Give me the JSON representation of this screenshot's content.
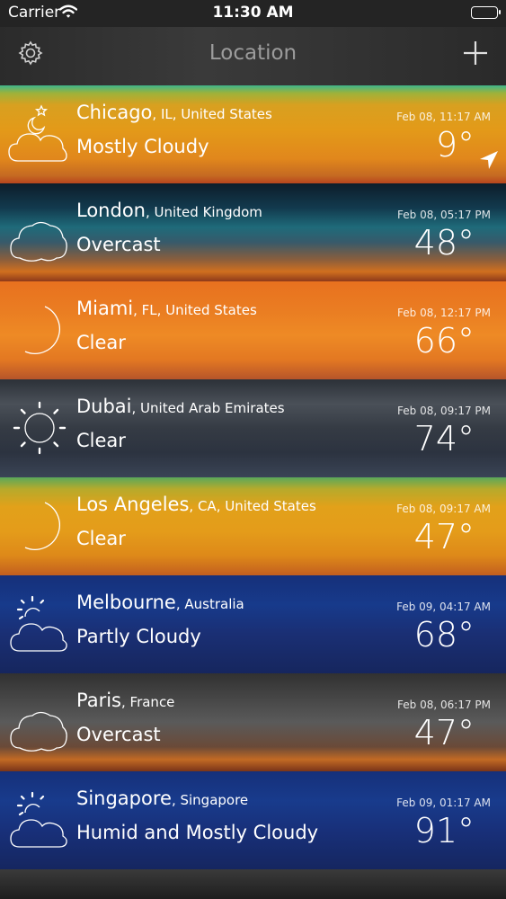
{
  "status_bar": {
    "carrier": "Carrier",
    "time": "11:30 AM"
  },
  "nav": {
    "title": "Location"
  },
  "locations": [
    {
      "city": "Chicago",
      "region": ", IL, United States",
      "condition": "Mostly Cloudy",
      "date": "Feb 08, 11:17 AM",
      "temp": "9°",
      "icon": "partly-cloudy-night-icon",
      "current_location": true
    },
    {
      "city": "London",
      "region": ", United Kingdom",
      "condition": "Overcast",
      "date": "Feb 08, 05:17 PM",
      "temp": "48°",
      "icon": "cloud-icon"
    },
    {
      "city": "Miami",
      "region": ", FL, United States",
      "condition": "Clear",
      "date": "Feb 08, 12:17 PM",
      "temp": "66°",
      "icon": "moon-icon"
    },
    {
      "city": "Dubai",
      "region": ", United Arab Emirates",
      "condition": "Clear",
      "date": "Feb 08, 09:17 PM",
      "temp": "74°",
      "icon": "sun-icon"
    },
    {
      "city": "Los Angeles",
      "region": ", CA, United States",
      "condition": "Clear",
      "date": "Feb 08, 09:17 AM",
      "temp": "47°",
      "icon": "moon-icon"
    },
    {
      "city": "Melbourne",
      "region": ", Australia",
      "condition": "Partly Cloudy",
      "date": "Feb 09, 04:17 AM",
      "temp": "68°",
      "icon": "partly-cloudy-day-icon"
    },
    {
      "city": "Paris",
      "region": ", France",
      "condition": "Overcast",
      "date": "Feb 08, 06:17 PM",
      "temp": "47°",
      "icon": "cloud-icon"
    },
    {
      "city": "Singapore",
      "region": ", Singapore",
      "condition": "Humid and Mostly Cloudy",
      "date": "Feb 09, 01:17 AM",
      "temp": "91°",
      "icon": "partly-cloudy-day-icon"
    }
  ]
}
